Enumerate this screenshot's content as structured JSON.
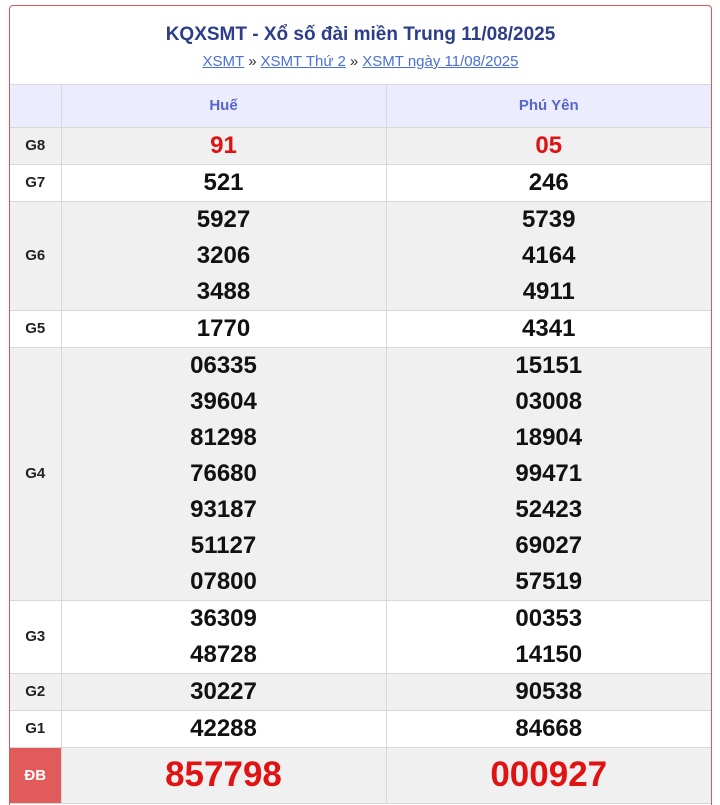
{
  "header": {
    "title": "KQXSMT - Xổ số đài miền Trung 11/08/2025",
    "breadcrumb": [
      {
        "label": "XSMT"
      },
      {
        "label": "XSMT Thứ 2"
      },
      {
        "label": "XSMT ngày 11/08/2025"
      }
    ],
    "separator": "»"
  },
  "table": {
    "columns": [
      "",
      "Huế",
      "Phú Yên"
    ],
    "rows": [
      {
        "label": "G8",
        "hue": [
          "91"
        ],
        "phuyen": [
          "05"
        ]
      },
      {
        "label": "G7",
        "hue": [
          "521"
        ],
        "phuyen": [
          "246"
        ]
      },
      {
        "label": "G6",
        "hue": [
          "5927",
          "3206",
          "3488"
        ],
        "phuyen": [
          "5739",
          "4164",
          "4911"
        ]
      },
      {
        "label": "G5",
        "hue": [
          "1770"
        ],
        "phuyen": [
          "4341"
        ]
      },
      {
        "label": "G4",
        "hue": [
          "06335",
          "39604",
          "81298",
          "76680",
          "93187",
          "51127",
          "07800"
        ],
        "phuyen": [
          "15151",
          "03008",
          "18904",
          "99471",
          "52423",
          "69027",
          "57519"
        ]
      },
      {
        "label": "G3",
        "hue": [
          "36309",
          "48728"
        ],
        "phuyen": [
          "00353",
          "14150"
        ]
      },
      {
        "label": "G2",
        "hue": [
          "30227"
        ],
        "phuyen": [
          "90538"
        ]
      },
      {
        "label": "G1",
        "hue": [
          "42288"
        ],
        "phuyen": [
          "84668"
        ]
      },
      {
        "label": "ĐB",
        "hue": [
          "857798"
        ],
        "phuyen": [
          "000927"
        ]
      }
    ]
  },
  "colors": {
    "accent_red": "#e01212",
    "title_blue": "#2c3e8a",
    "header_bg": "#ececff",
    "db_label_bg": "#e15b5b"
  }
}
